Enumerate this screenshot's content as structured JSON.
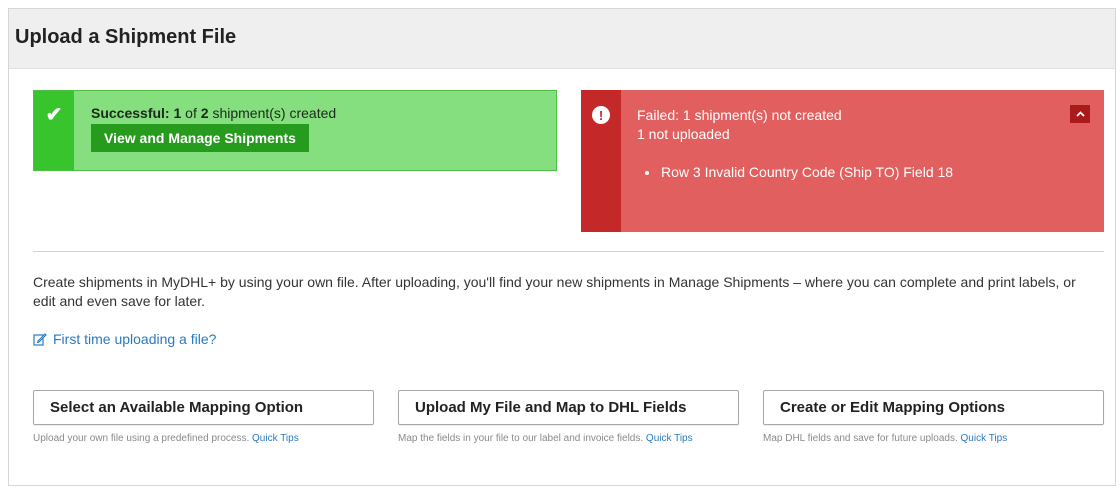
{
  "page": {
    "title": "Upload a Shipment File"
  },
  "success_alert": {
    "prefix": "Successful:",
    "count": "1",
    "of_text": "of",
    "total": "2",
    "suffix": "shipment(s) created",
    "button_label": "View and Manage Shipments",
    "icon": "check-icon",
    "colors": {
      "stripe": "#37c42c",
      "background": "#86df7f",
      "button": "#269b1e"
    }
  },
  "failed_alert": {
    "line1": "Failed: 1 shipment(s) not created",
    "line2": "1 not uploaded",
    "errors": [
      "Row 3 Invalid Country Code (Ship TO) Field 18"
    ],
    "collapse_icon": "^",
    "icon": "exclamation-icon",
    "colors": {
      "stripe": "#c42828",
      "background": "#e25f5f"
    }
  },
  "description": "Create shipments in MyDHL+ by using your own file. After uploading, you'll find your new shipments in Manage Shipments – where you can complete and print labels, or edit and even save for later.",
  "first_time_link": "First time uploading a file?",
  "options": [
    {
      "label": "Select an Available Mapping Option",
      "desc": "Upload your own file using a predefined process.",
      "tip": "Quick Tips"
    },
    {
      "label": "Upload My File and Map to DHL Fields",
      "desc": "Map the fields in your file to our label and invoice fields.",
      "tip": "Quick Tips"
    },
    {
      "label": "Create or Edit Mapping Options",
      "desc": "Map DHL fields and save for future uploads.",
      "tip": "Quick Tips"
    }
  ]
}
